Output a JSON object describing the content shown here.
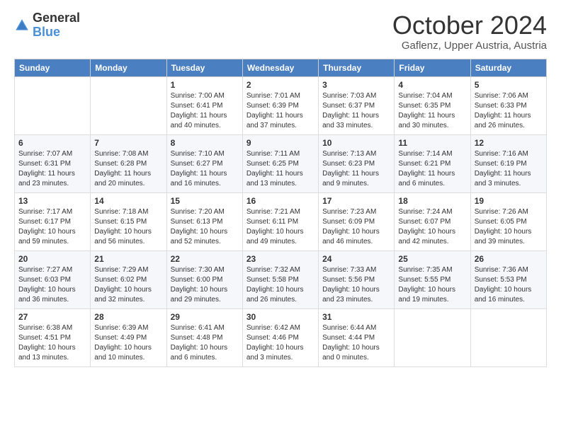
{
  "logo": {
    "text_general": "General",
    "text_blue": "Blue"
  },
  "header": {
    "month": "October 2024",
    "location": "Gaflenz, Upper Austria, Austria"
  },
  "weekdays": [
    "Sunday",
    "Monday",
    "Tuesday",
    "Wednesday",
    "Thursday",
    "Friday",
    "Saturday"
  ],
  "weeks": [
    [
      {
        "day": "",
        "info": ""
      },
      {
        "day": "",
        "info": ""
      },
      {
        "day": "1",
        "info": "Sunrise: 7:00 AM\nSunset: 6:41 PM\nDaylight: 11 hours and 40 minutes."
      },
      {
        "day": "2",
        "info": "Sunrise: 7:01 AM\nSunset: 6:39 PM\nDaylight: 11 hours and 37 minutes."
      },
      {
        "day": "3",
        "info": "Sunrise: 7:03 AM\nSunset: 6:37 PM\nDaylight: 11 hours and 33 minutes."
      },
      {
        "day": "4",
        "info": "Sunrise: 7:04 AM\nSunset: 6:35 PM\nDaylight: 11 hours and 30 minutes."
      },
      {
        "day": "5",
        "info": "Sunrise: 7:06 AM\nSunset: 6:33 PM\nDaylight: 11 hours and 26 minutes."
      }
    ],
    [
      {
        "day": "6",
        "info": "Sunrise: 7:07 AM\nSunset: 6:31 PM\nDaylight: 11 hours and 23 minutes."
      },
      {
        "day": "7",
        "info": "Sunrise: 7:08 AM\nSunset: 6:28 PM\nDaylight: 11 hours and 20 minutes."
      },
      {
        "day": "8",
        "info": "Sunrise: 7:10 AM\nSunset: 6:27 PM\nDaylight: 11 hours and 16 minutes."
      },
      {
        "day": "9",
        "info": "Sunrise: 7:11 AM\nSunset: 6:25 PM\nDaylight: 11 hours and 13 minutes."
      },
      {
        "day": "10",
        "info": "Sunrise: 7:13 AM\nSunset: 6:23 PM\nDaylight: 11 hours and 9 minutes."
      },
      {
        "day": "11",
        "info": "Sunrise: 7:14 AM\nSunset: 6:21 PM\nDaylight: 11 hours and 6 minutes."
      },
      {
        "day": "12",
        "info": "Sunrise: 7:16 AM\nSunset: 6:19 PM\nDaylight: 11 hours and 3 minutes."
      }
    ],
    [
      {
        "day": "13",
        "info": "Sunrise: 7:17 AM\nSunset: 6:17 PM\nDaylight: 10 hours and 59 minutes."
      },
      {
        "day": "14",
        "info": "Sunrise: 7:18 AM\nSunset: 6:15 PM\nDaylight: 10 hours and 56 minutes."
      },
      {
        "day": "15",
        "info": "Sunrise: 7:20 AM\nSunset: 6:13 PM\nDaylight: 10 hours and 52 minutes."
      },
      {
        "day": "16",
        "info": "Sunrise: 7:21 AM\nSunset: 6:11 PM\nDaylight: 10 hours and 49 minutes."
      },
      {
        "day": "17",
        "info": "Sunrise: 7:23 AM\nSunset: 6:09 PM\nDaylight: 10 hours and 46 minutes."
      },
      {
        "day": "18",
        "info": "Sunrise: 7:24 AM\nSunset: 6:07 PM\nDaylight: 10 hours and 42 minutes."
      },
      {
        "day": "19",
        "info": "Sunrise: 7:26 AM\nSunset: 6:05 PM\nDaylight: 10 hours and 39 minutes."
      }
    ],
    [
      {
        "day": "20",
        "info": "Sunrise: 7:27 AM\nSunset: 6:03 PM\nDaylight: 10 hours and 36 minutes."
      },
      {
        "day": "21",
        "info": "Sunrise: 7:29 AM\nSunset: 6:02 PM\nDaylight: 10 hours and 32 minutes."
      },
      {
        "day": "22",
        "info": "Sunrise: 7:30 AM\nSunset: 6:00 PM\nDaylight: 10 hours and 29 minutes."
      },
      {
        "day": "23",
        "info": "Sunrise: 7:32 AM\nSunset: 5:58 PM\nDaylight: 10 hours and 26 minutes."
      },
      {
        "day": "24",
        "info": "Sunrise: 7:33 AM\nSunset: 5:56 PM\nDaylight: 10 hours and 23 minutes."
      },
      {
        "day": "25",
        "info": "Sunrise: 7:35 AM\nSunset: 5:55 PM\nDaylight: 10 hours and 19 minutes."
      },
      {
        "day": "26",
        "info": "Sunrise: 7:36 AM\nSunset: 5:53 PM\nDaylight: 10 hours and 16 minutes."
      }
    ],
    [
      {
        "day": "27",
        "info": "Sunrise: 6:38 AM\nSunset: 4:51 PM\nDaylight: 10 hours and 13 minutes."
      },
      {
        "day": "28",
        "info": "Sunrise: 6:39 AM\nSunset: 4:49 PM\nDaylight: 10 hours and 10 minutes."
      },
      {
        "day": "29",
        "info": "Sunrise: 6:41 AM\nSunset: 4:48 PM\nDaylight: 10 hours and 6 minutes."
      },
      {
        "day": "30",
        "info": "Sunrise: 6:42 AM\nSunset: 4:46 PM\nDaylight: 10 hours and 3 minutes."
      },
      {
        "day": "31",
        "info": "Sunrise: 6:44 AM\nSunset: 4:44 PM\nDaylight: 10 hours and 0 minutes."
      },
      {
        "day": "",
        "info": ""
      },
      {
        "day": "",
        "info": ""
      }
    ]
  ]
}
